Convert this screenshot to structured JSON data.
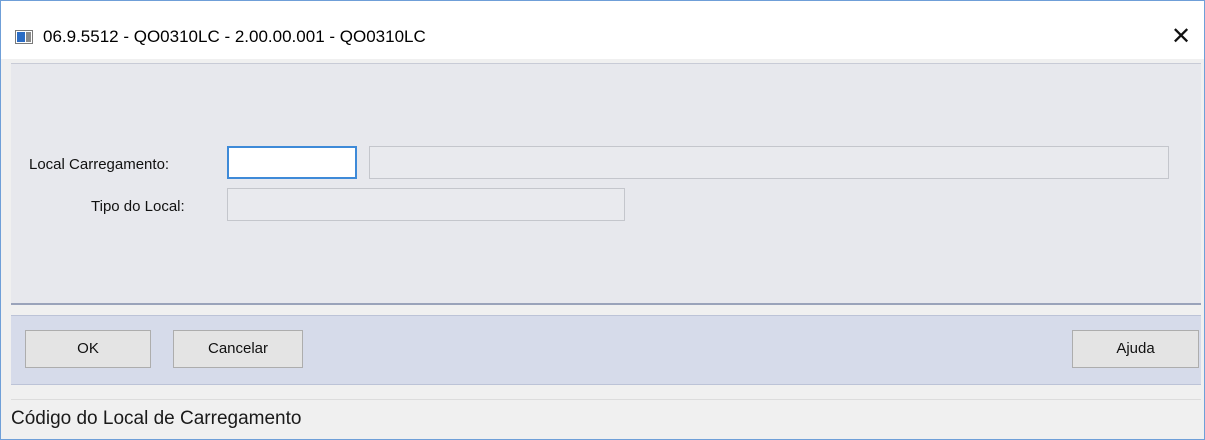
{
  "window": {
    "title": "06.9.5512 - QO0310LC - 2.00.00.001 - QO0310LC",
    "close_glyph": "✕"
  },
  "form": {
    "local_carregamento": {
      "label": "Local Carregamento:",
      "value": "",
      "description": ""
    },
    "tipo_local": {
      "label": "Tipo do Local:",
      "value": ""
    }
  },
  "buttons": {
    "ok": "OK",
    "cancel": "Cancelar",
    "help": "Ajuda"
  },
  "status": {
    "text": "Código do Local de Carregamento"
  },
  "colors": {
    "focus_border": "#3e8ad8",
    "button_bar": "#d6dbea",
    "form_bg": "#e7e8ed"
  }
}
